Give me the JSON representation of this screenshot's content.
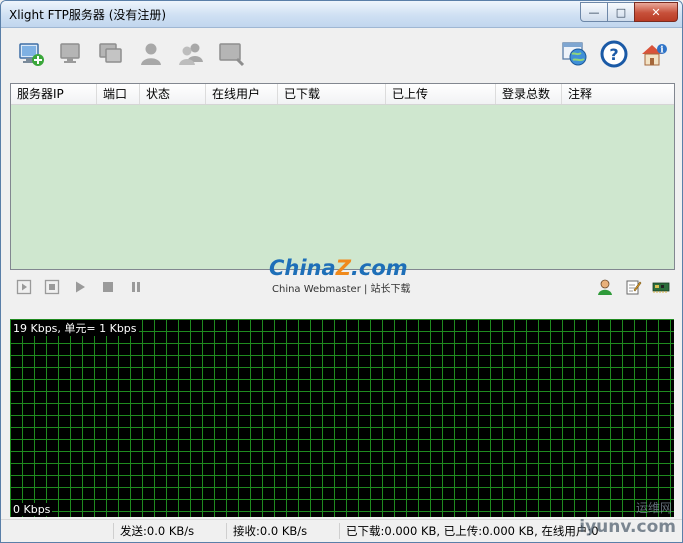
{
  "window": {
    "title": "Xlight FTP服务器 (没有注册)",
    "controls": {
      "minimize": "—",
      "maximize": "□",
      "close": "✕"
    }
  },
  "toolbar": {
    "icons": [
      "add-server-icon",
      "server-icon",
      "server-copy-icon",
      "user-icon",
      "users-icon",
      "log-icon",
      "globe-window-icon",
      "help-icon",
      "about-icon"
    ]
  },
  "list": {
    "columns": [
      "服务器IP",
      "端口",
      "状态",
      "在线用户",
      "已下载",
      "已上传",
      "登录总数",
      "注释"
    ]
  },
  "logo": {
    "main_a": "China",
    "main_z": "Z",
    "main_b": ".com",
    "sub": "China Webmaster | 站长下载"
  },
  "graph": {
    "top_label": "19 Kbps, 单元= 1 Kbps",
    "bottom_label": "0 Kbps"
  },
  "status": {
    "send": "发送:0.0 KB/s",
    "recv": "接收:0.0 KB/s",
    "summary": "已下载:0.000 KB, 已上传:0.000 KB, 在线用户:0"
  },
  "watermark": {
    "cn": "运维网",
    "text": "iyunv.com"
  },
  "colors": {
    "list_bg": "#cfe7cf",
    "grid": "#1f8a1f",
    "graph_bg": "#000000",
    "logo_blue": "#1e6fb8",
    "logo_orange": "#f08a1c"
  }
}
